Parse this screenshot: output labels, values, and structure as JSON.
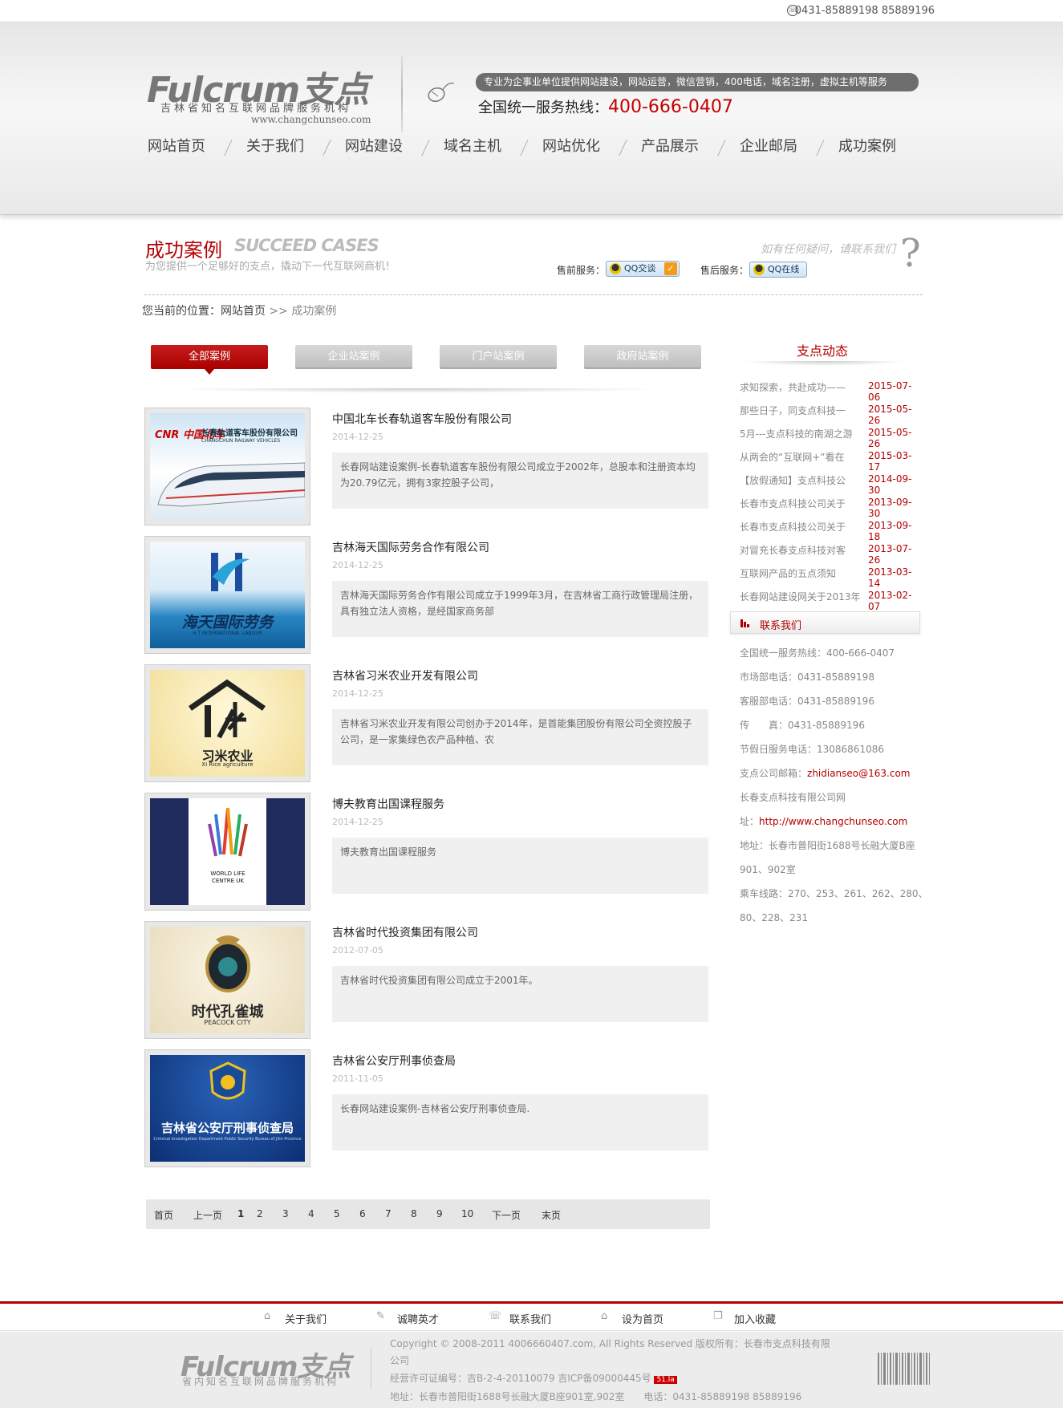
{
  "topbar": {
    "phone": "0431-85889198 85889196"
  },
  "header": {
    "logo": "Fulcrum支点",
    "logo_sub": "吉林省知名互联网品牌服务机构",
    "logo_url": "www.changchunseo.com",
    "slogan": "专业为企事业单位提供网站建设，网站运营，微信营销，400电话，域名注册，虚拟主机等服务",
    "hotline_label": "全国统一服务热线：",
    "hotline_number": "400-666-0407"
  },
  "nav": [
    "网站首页",
    "关于我们",
    "网站建设",
    "域名主机",
    "网站优化",
    "产品展示",
    "企业邮局",
    "成功案例"
  ],
  "banner": {
    "title": "成功案例",
    "title_en": "SUCCEED CASES",
    "subtitle": "为您提供一个足够好的支点，撬动下一代互联网商机！",
    "help": "如有任何疑问，请联系我们",
    "presale_label": "售前服务：",
    "presale_btn": "QQ交谈",
    "aftersale_label": "售后服务：",
    "aftersale_btn": "QQ在线"
  },
  "breadcrumb": {
    "prefix": "您当前的位置：",
    "home": "网站首页",
    "sep": ">>",
    "current": "成功案例"
  },
  "tabs": [
    "全部案例",
    "企业站案例",
    "门户站案例",
    "政府站案例"
  ],
  "cases": [
    {
      "title": "中国北车长春轨道客车股份有限公司",
      "date": "2014-12-25",
      "desc": "长春网站建设案例-长春轨道客车股份有限公司成立于2002年，总股本和注册资本均为20.79亿元，拥有3家控股子公司，",
      "img_text": "长春轨道客车股份有限公司",
      "img_sub": "CHANGCHUN RAILWAY VEHICLES",
      "img_logo": "CNR 中国北车"
    },
    {
      "title": "吉林海天国际劳务合作有限公司",
      "date": "2014-12-25",
      "desc": "吉林海天国际劳务合作有限公司成立于1999年3月，在吉林省工商行政管理局注册，具有独立法人资格，是经国家商务部",
      "img_text": "海天国际劳务",
      "img_sub": "H.T INTERNATIONAL LABOUR"
    },
    {
      "title": "吉林省习米农业开发有限公司",
      "date": "2014-12-25",
      "desc": "吉林省习米农业开发有限公司创办于2014年，是首能集团股份有限公司全资控股子公司，是一家集绿色农产品种植、农",
      "img_text": "习米农业",
      "img_sub": "Xi Rice agriculture"
    },
    {
      "title": "博夫教育出国课程服务",
      "date": "2014-12-25",
      "desc": "博夫教育出国课程服务",
      "img_text": "WORLD LIFE CENTRE UK"
    },
    {
      "title": "吉林省时代投资集团有限公司",
      "date": "2012-07-05",
      "desc": "吉林省时代投资集团有限公司成立于2001年。",
      "img_text": "时代孔雀城",
      "img_sub": "PEACOCK CITY"
    },
    {
      "title": "吉林省公安厅刑事侦查局",
      "date": "2011-11-05",
      "desc": "长春网站建设案例-吉林省公安厅刑事侦查局.",
      "img_text": "吉林省公安厅刑事侦查局",
      "img_sub": "Criminal Investigation Department Public Security Bureau of Jilin Province"
    }
  ],
  "pager": {
    "first": "首页",
    "prev": "上一页",
    "pages": [
      "1",
      "2",
      "3",
      "4",
      "5",
      "6",
      "7",
      "8",
      "9",
      "10"
    ],
    "next": "下一页",
    "last": "末页"
  },
  "sidebar": {
    "news_title": "支点动态",
    "news": [
      {
        "t": "求知探索，共赴成功——",
        "d": "2015-07-06"
      },
      {
        "t": "那些日子，同支点科技一",
        "d": "2015-05-26"
      },
      {
        "t": "5月---支点科技的南湖之游",
        "d": "2015-05-26"
      },
      {
        "t": "从两会的“互联网+”看在",
        "d": "2015-03-17"
      },
      {
        "t": "【放假通知】支点科技公",
        "d": "2014-09-30"
      },
      {
        "t": "长春市支点科技公司关于",
        "d": "2013-09-30"
      },
      {
        "t": "长春市支点科技公司关于",
        "d": "2013-09-18"
      },
      {
        "t": "对冒充长春支点科技对客",
        "d": "2013-07-26"
      },
      {
        "t": "互联网产品的五点须知",
        "d": "2013-03-14"
      },
      {
        "t": "长春网站建设网关于2013年",
        "d": "2013-02-07"
      }
    ],
    "contact_title": "联系我们",
    "contact": [
      "全国统一服务热线：400-666-0407",
      "市场部电话：0431-85889198",
      "客服部电话：0431-85889196",
      "传　　真：0431-85889196",
      "节假日服务电话：13086861086"
    ],
    "email_label": "支点公司邮箱：",
    "email": "zhidianseo@163.com",
    "site_label": "长春支点科技有限公司网",
    "url_label": "址：",
    "url": "http://www.changchunseo.com",
    "address1": "地址：长春市普阳街1688号长融大厦B座",
    "address2": "901、902室",
    "bus1": "乘车线路：270、253、261、262、280、",
    "bus2": "80、228、231"
  },
  "footer": {
    "links": [
      "关于我们",
      "诚聘英才",
      "联系我们",
      "设为首页",
      "加入收藏"
    ],
    "logo": "Fulcrum支点",
    "logo_sub": "省内知名互联网品牌服务机构",
    "copyright": "Copyright © 2008-2011 4006660407.com, All Rights Reserved 版权所有：长春市支点科技有限",
    "copyright2": "公司",
    "license": "经营许可证编号：吉B-2-4-20110079 吉ICP备09000445号",
    "badge": "51.la",
    "address": "地址：长春市普阳街1688号长融大厦B座901室,902室　　电话：0431-85889198 85889196"
  },
  "colors": {
    "accent": "#b40000",
    "nav_text": "#444444",
    "tab_gray": "#c4c4c4"
  }
}
